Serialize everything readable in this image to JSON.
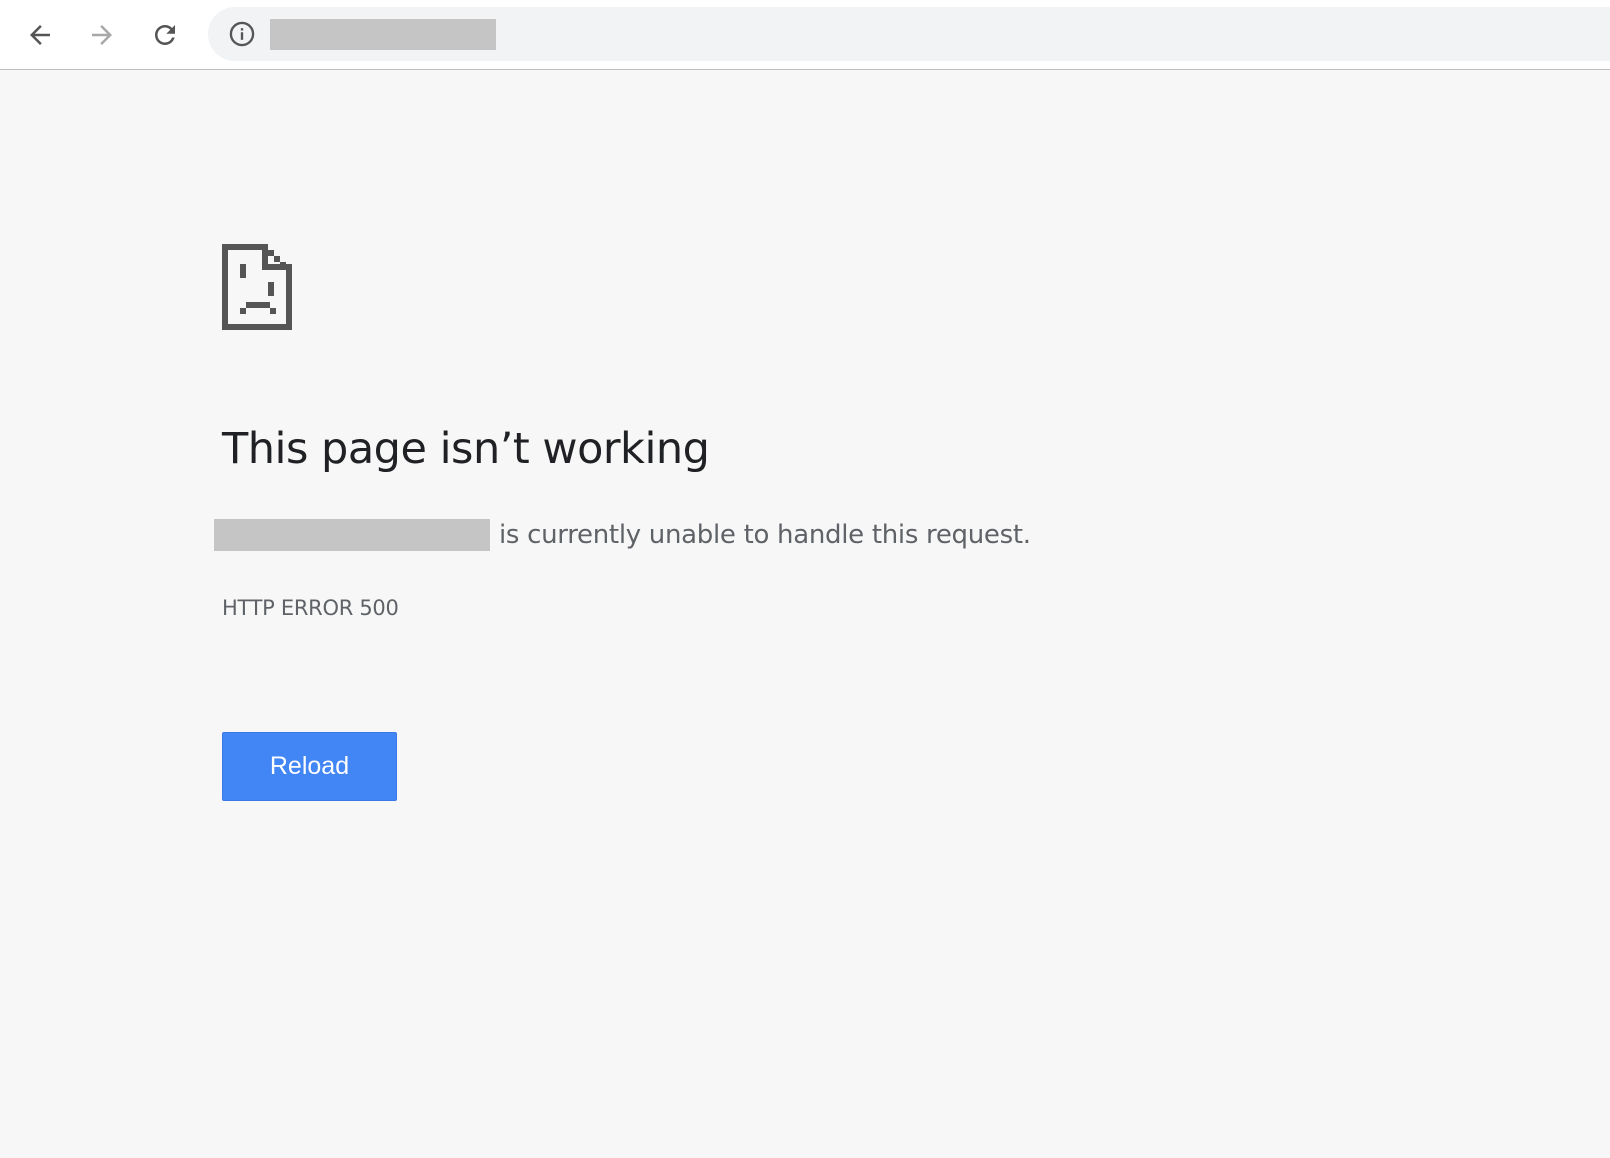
{
  "toolbar": {
    "back_icon": "arrow-left-icon",
    "forward_icon": "arrow-right-icon",
    "reload_icon": "reload-icon",
    "site_info_icon": "info-circle-icon",
    "url": ""
  },
  "error_page": {
    "icon": "sad-document-icon",
    "title": "This page isn’t working",
    "host": "",
    "message": "is currently unable to handle this request.",
    "error_code": "HTTP ERROR 500",
    "reload_label": "Reload"
  },
  "colors": {
    "background": "#f7f7f7",
    "toolbar_background": "#ffffff",
    "omnibox_background": "#f1f3f4",
    "button_blue": "#4285f4",
    "title_text": "#202124",
    "secondary_text": "#5f6368",
    "redaction": "#c5c5c5",
    "icon_gray": "#555555"
  }
}
